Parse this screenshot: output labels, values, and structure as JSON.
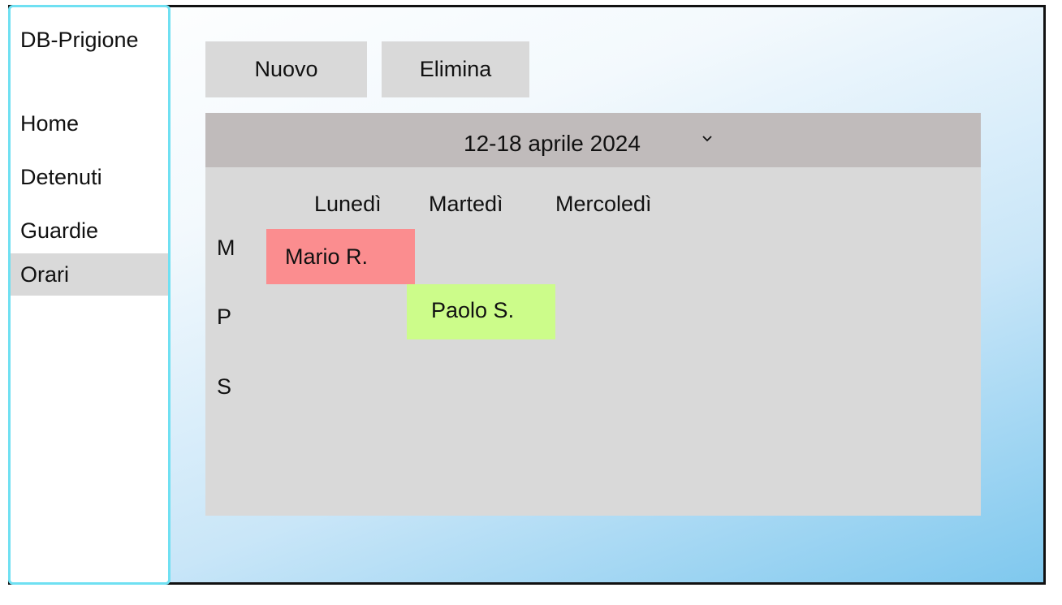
{
  "sidebar": {
    "brand": "DB-Prigione",
    "items": [
      {
        "label": "Home",
        "active": false
      },
      {
        "label": "Detenuti",
        "active": false
      },
      {
        "label": "Guardie",
        "active": false
      },
      {
        "label": "Orari",
        "active": true
      }
    ]
  },
  "toolbar": {
    "new_label": "Nuovo",
    "delete_label": "Elimina"
  },
  "calendar": {
    "week": "12-18 aprile 2024",
    "days": [
      "Lunedì",
      "Martedì",
      "Mercoledì"
    ],
    "shifts": [
      "M",
      "P",
      "S"
    ],
    "events": [
      {
        "name": "Mario R.",
        "day": "Lunedì",
        "shift": "M",
        "color": "#fb8d8f"
      },
      {
        "name": "Paolo S.",
        "day": "Martedì",
        "shift": "P",
        "color": "#ccfc8a"
      }
    ]
  },
  "colors": {
    "sidebar_border": "#6fe0f2",
    "active_item": "#d9d9d9",
    "panel": "#d9d9d9",
    "panel_header": "#c0bbbb"
  }
}
